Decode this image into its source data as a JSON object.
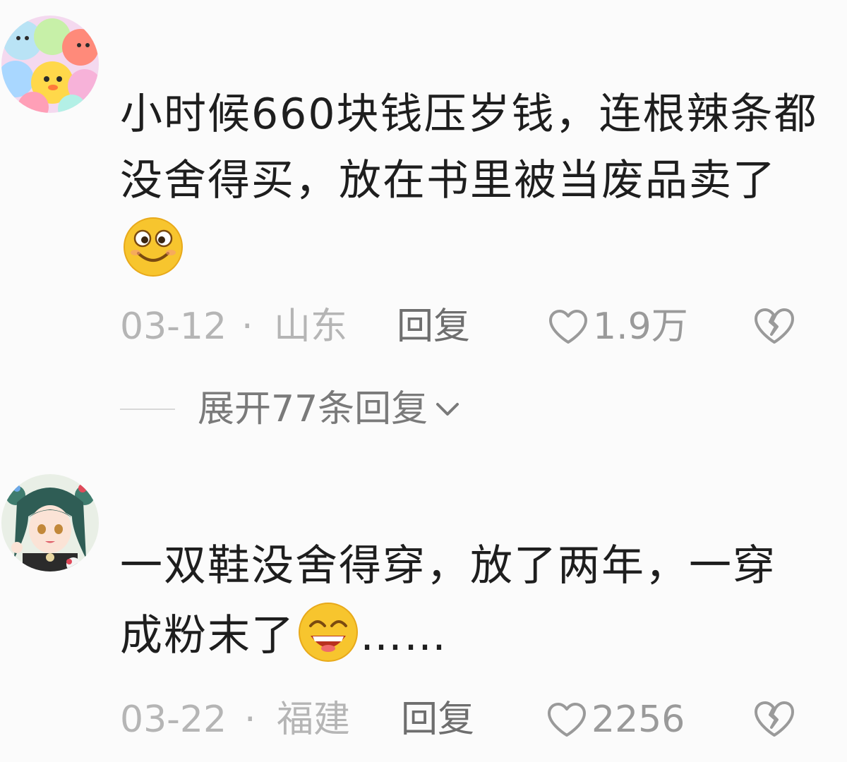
{
  "comments": [
    {
      "text": "小时候660块钱压岁钱，连根辣条都没舍得买，放在书里被当废品卖了",
      "emoji": "smile-emoji",
      "date": "03-12",
      "separator": "·",
      "location": "山东",
      "reply_label": "回复",
      "like_count": "1.9万",
      "expand_replies_label": "展开77条回复"
    },
    {
      "text": "一双鞋没舍得穿，放了两年，一穿成粉末了",
      "emoji": "grin-emoji",
      "trailing_text": "……",
      "date": "03-22",
      "separator": "·",
      "location": "福建",
      "reply_label": "回复",
      "like_count": "2256"
    }
  ],
  "icons": {
    "like": "heart-outline-icon",
    "dislike": "broken-heart-icon",
    "expand": "chevron-down-icon"
  },
  "colors": {
    "background": "#fbfbfb",
    "text_primary": "#1e1e1e",
    "text_meta": "#b5b5b5",
    "text_action": "#6e6e6e",
    "emoji_yellow": "#f7c52e"
  }
}
